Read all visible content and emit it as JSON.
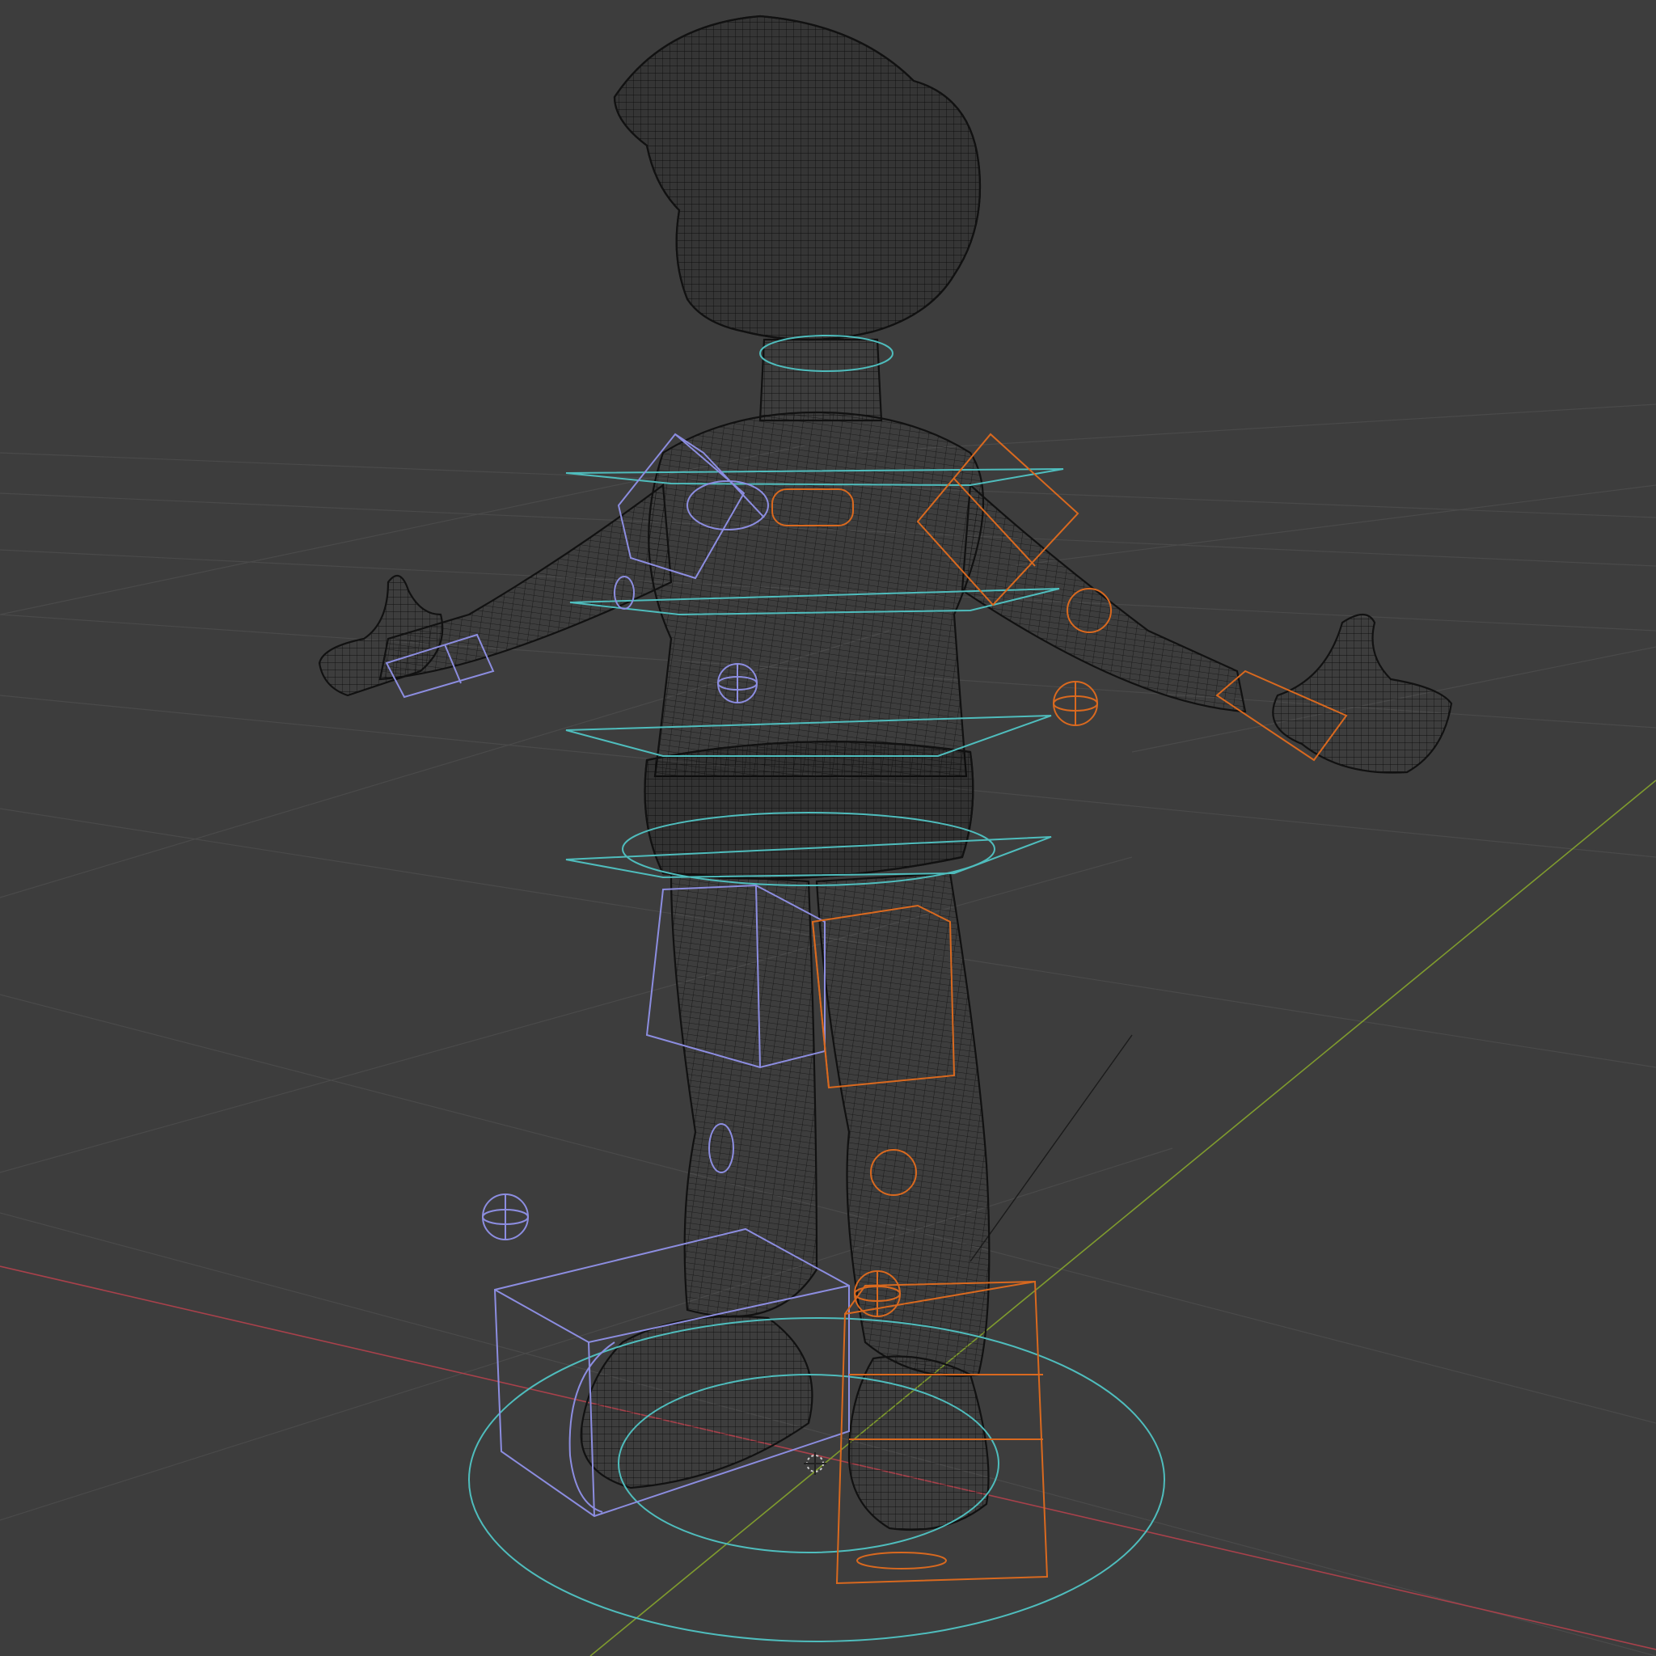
{
  "viewport": {
    "shading_mode": "wireframe",
    "background_color": "#3d3d3d",
    "grid_color": "#4a4a4a",
    "x_axis_color": "#a8414b",
    "y_axis_color": "#7f9b2e",
    "mesh_wire_color": "#141414",
    "left_controls_color": "#8c8de0",
    "right_controls_color": "#d9691f",
    "center_controls_color": "#4fbdbd"
  },
  "scene": {
    "character": "cartoon-boy-mesh",
    "rig": "control-rig",
    "origin_marker": "3d-cursor"
  }
}
